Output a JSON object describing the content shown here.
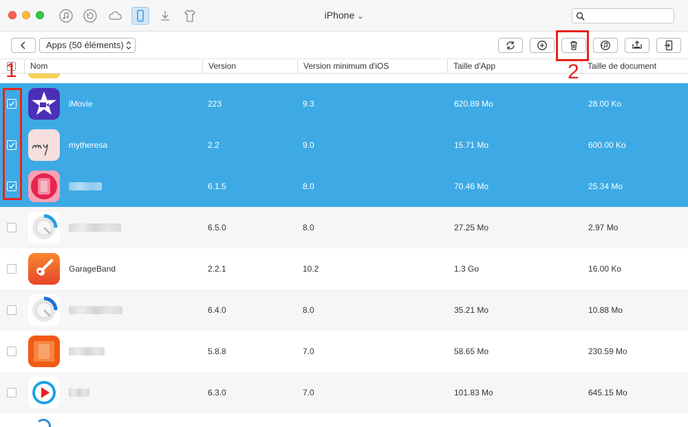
{
  "window": {
    "title": "iPhone",
    "title_caret": "⌄"
  },
  "search": {
    "placeholder": ""
  },
  "nav_icons": [
    "music-note-icon",
    "history-icon",
    "cloud-icon",
    "iphone-icon",
    "download-icon",
    "tshirt-icon"
  ],
  "toolbar": {
    "apps_select_label": "Apps (50 éléments)",
    "buttons": [
      "refresh-icon",
      "add-icon",
      "trash-icon",
      "itunes-icon",
      "to-computer-icon",
      "to-device-icon"
    ]
  },
  "annotations": {
    "one": "1",
    "two": "2"
  },
  "columns": {
    "name": "Nom",
    "version": "Version",
    "min_ios": "Version minimum d'iOS",
    "app_size": "Taille d'App",
    "doc_size": "Taille de document"
  },
  "rows": [
    {
      "name": "iMovie",
      "version": "223",
      "min_ios": "9.3",
      "app_size": "620.89 Mo",
      "doc_size": "28.00 Ko",
      "selected": true,
      "icon": "imovie-icon"
    },
    {
      "name": "mytheresa",
      "version": "2.2",
      "min_ios": "9.0",
      "app_size": "15.71 Mo",
      "doc_size": "600.00 Ko",
      "selected": true,
      "icon": "mytheresa-icon"
    },
    {
      "name": "",
      "version": "6.1.5",
      "min_ios": "8.0",
      "app_size": "70.46 Mo",
      "doc_size": "25.34 Mo",
      "selected": true,
      "icon": "pink-app-icon"
    },
    {
      "name": "",
      "version": "6.5.0",
      "min_ios": "8.0",
      "app_size": "27.25 Mo",
      "doc_size": "2.97 Mo",
      "selected": false,
      "icon": "timer-app-icon"
    },
    {
      "name": "GarageBand",
      "version": "2.2.1",
      "min_ios": "10.2",
      "app_size": "1.3 Go",
      "doc_size": "16.00 Ko",
      "selected": false,
      "icon": "garageband-icon"
    },
    {
      "name": "",
      "version": "6.4.0",
      "min_ios": "8.0",
      "app_size": "35.21 Mo",
      "doc_size": "10.88 Mo",
      "selected": false,
      "icon": "timer-app-icon"
    },
    {
      "name": "",
      "version": "5.8.8",
      "min_ios": "7.0",
      "app_size": "58.65 Mo",
      "doc_size": "230.59 Mo",
      "selected": false,
      "icon": "orange-app-icon"
    },
    {
      "name": "",
      "version": "6.3.0",
      "min_ios": "7.0",
      "app_size": "101.83 Mo",
      "doc_size": "645.15 Mo",
      "selected": false,
      "icon": "play-app-icon"
    }
  ],
  "colors": {
    "selection": "#3daae5",
    "annotation": "#e8231a",
    "row_alt": "#f6f6f6"
  }
}
